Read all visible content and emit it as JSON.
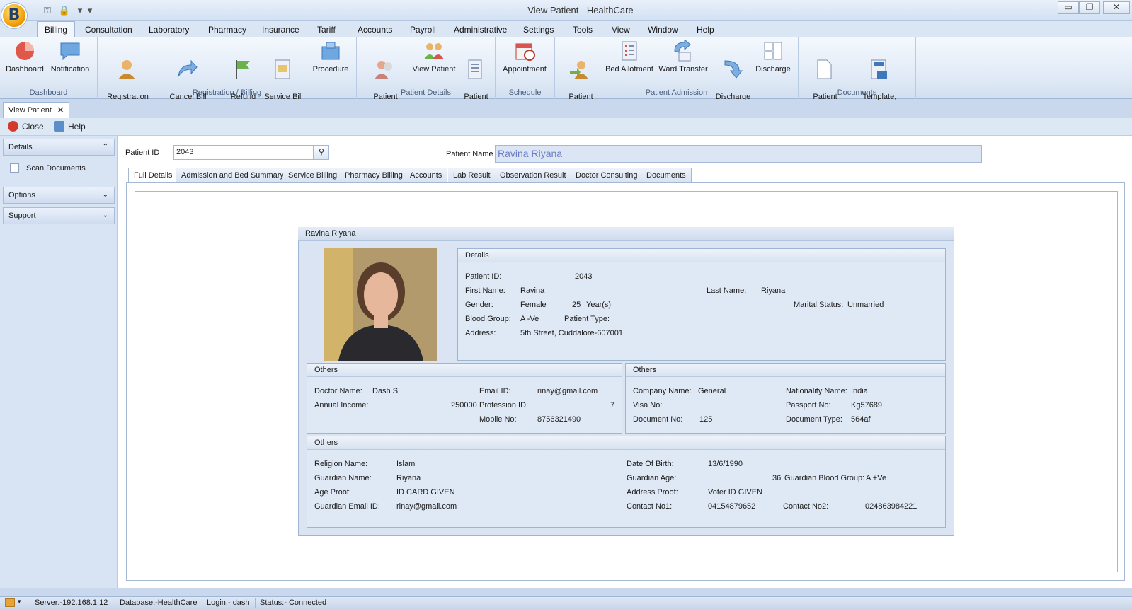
{
  "window": {
    "title": "View Patient - HealthCare",
    "app_letter": "B",
    "min": "▭",
    "restore": "❐",
    "close": "✕"
  },
  "menu": [
    "Billing",
    "Consultation",
    "Laboratory",
    "Pharmacy",
    "Insurance",
    "Tariff",
    "Accounts",
    "Payroll",
    "Administrative",
    "Settings",
    "Tools",
    "View",
    "Window",
    "Help"
  ],
  "ribbon": {
    "groups": [
      "Dashboard",
      "Registration / Billing",
      "Patient Details",
      "Schedule",
      "Patient Admission",
      "Documents"
    ],
    "buttons": {
      "dashboard": "Dashboard",
      "notification": "Notification",
      "registration_billing": "Registration\nBilling",
      "cancel_bill": "Cancel Bill\n(Request/Refund)",
      "refund_approval": "Refund\nApproval",
      "service_bill_history": "Service Bill\nHistory",
      "procedure": "Procedure",
      "patient_registration": "Patient\nRegistration",
      "view_patient": "View Patient",
      "patient_list": "Patient\nList",
      "appointment": "Appointment",
      "patient_admission": "Patient\nAdmission",
      "bed_allotment": "Bed Allotment",
      "ward_transfer": "Ward Transfer",
      "discharge_request": "Discharge\nRequest",
      "discharge": "Discharge",
      "patient_documents": "Patient\nDocuments",
      "template_mail": "Template,\nMail & Document"
    }
  },
  "doc_tab": {
    "label": "View Patient",
    "close": "✕"
  },
  "toolbar": {
    "close": "Close",
    "help": "Help"
  },
  "left_panel": {
    "details": "Details",
    "scan_documents": "Scan Documents",
    "options": "Options",
    "support": "Support",
    "chev_up": "⌃",
    "chev_down": "⌄"
  },
  "search": {
    "patient_id_label": "Patient ID",
    "patient_id": "2043",
    "patient_name_label": "Patient Name",
    "patient_name": "Ravina Riyana"
  },
  "tabs": [
    "Full Details",
    "Admission and Bed Summary",
    "Service Billing",
    "Pharmacy Billing",
    "Accounts",
    "Lab Result",
    "Observation Result",
    "Doctor Consulting",
    "Documents"
  ],
  "card": {
    "title": "Ravina Riyana"
  },
  "details": {
    "title": "Details",
    "patient_id_label": "Patient ID:",
    "patient_id": "2043",
    "first_name_label": "First Name:",
    "first_name": "Ravina",
    "last_name_label": "Last Name:",
    "last_name": "Riyana",
    "gender_label": "Gender:",
    "gender": "Female",
    "age": "25",
    "age_unit": "Year(s)",
    "marital_label": "Marital Status:",
    "marital": "Unmarried",
    "blood_label": "Blood Group:",
    "blood": "A -Ve",
    "patient_type_label": "Patient Type:",
    "address_label": "Address:",
    "address": "5th Street, Cuddalore-607001"
  },
  "others1": {
    "title": "Others",
    "doctor_label": "Doctor Name:",
    "doctor": "Dash S",
    "email_label": "Email ID:",
    "email": "rinay@gmail.com",
    "income_label": "Annual Income:",
    "income": "250000",
    "profession_label": "Profession ID:",
    "profession": "7",
    "mobile_label": "Mobile No:",
    "mobile": "8756321490"
  },
  "others2": {
    "title": "Others",
    "company_label": "Company Name:",
    "company": "General",
    "nationality_label": "Nationality Name:",
    "nationality": "India",
    "visa_label": "Visa No:",
    "passport_label": "Passport No:",
    "passport": "Kg57689",
    "document_no_label": "Document No:",
    "document_no": "125",
    "document_type_label": "Document Type:",
    "document_type": "564af"
  },
  "others3": {
    "title": "Others",
    "religion_label": "Religion Name:",
    "religion": "Islam",
    "dob_label": "Date Of Birth:",
    "dob": "13/6/1990",
    "guardian_label": "Guardian Name:",
    "guardian": "Riyana",
    "guardian_age_label": "Guardian Age:",
    "guardian_age": "36",
    "guardian_blood_label": "Guardian Blood Group:",
    "guardian_blood": "A +Ve",
    "age_proof_label": "Age Proof:",
    "age_proof": "ID CARD GIVEN",
    "address_proof_label": "Address Proof:",
    "address_proof": "Voter ID GIVEN",
    "guardian_email_label": "Guardian Email ID:",
    "guardian_email": "rinay@gmail.com",
    "contact1_label": "Contact No1:",
    "contact1": "04154879652",
    "contact2_label": "Contact No2:",
    "contact2": "024863984221"
  },
  "status": {
    "server": "Server:-192.168.1.12",
    "database": "Database:-HealthCare",
    "login": "Login:- dash",
    "state": "Status:- Connected"
  },
  "colors": {
    "accent": "#2b5797",
    "ribbon": "#dfe9f6"
  }
}
